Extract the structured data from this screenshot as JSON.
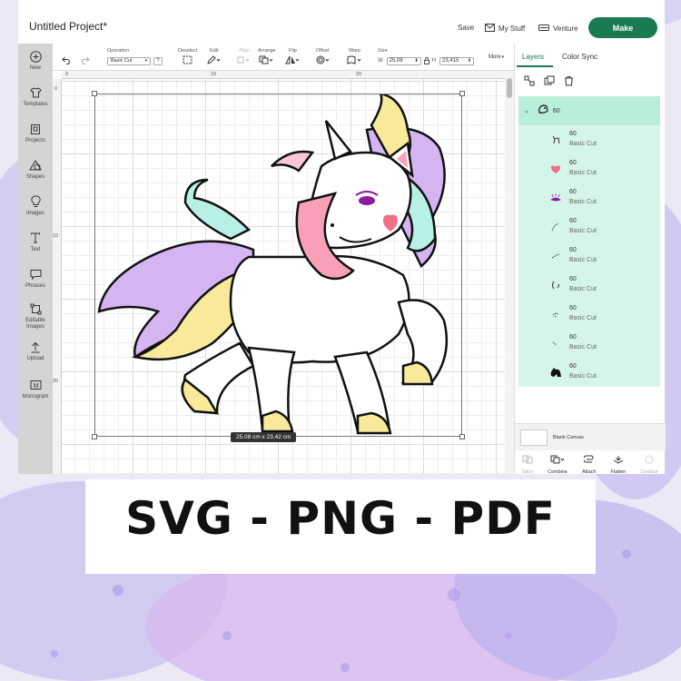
{
  "app": {
    "project_title": "Untitled Project*",
    "save_label": "Save",
    "my_stuff_label": "My Stuff",
    "venture_label": "Venture",
    "make_label": "Make",
    "accent_color": "#1a7a52"
  },
  "left_panel": {
    "items": [
      {
        "label": "New",
        "icon": "plus-circle-icon"
      },
      {
        "label": "Templates",
        "icon": "shirt-icon"
      },
      {
        "label": "Projects",
        "icon": "projects-icon"
      },
      {
        "label": "Shapes",
        "icon": "shapes-icon"
      },
      {
        "label": "Images",
        "icon": "lightbulb-icon"
      },
      {
        "label": "Text",
        "icon": "text-icon"
      },
      {
        "label": "Phrases",
        "icon": "speech-bubble-icon"
      },
      {
        "label": "Editable Images",
        "icon": "editable-images-icon"
      },
      {
        "label": "Upload",
        "icon": "upload-icon"
      },
      {
        "label": "Monogram",
        "icon": "monogram-icon"
      }
    ]
  },
  "toolbar": {
    "operation_label": "Operation",
    "operation_value": "Basic Cut",
    "deselect_label": "Deselect",
    "edit_label": "Edit",
    "align_label": "Align",
    "arrange_label": "Arrange",
    "flip_label": "Flip",
    "offset_label": "Offset",
    "warp_label": "Warp",
    "size_label": "Size",
    "width_prefix": "W",
    "width_value": "25,08",
    "height_prefix": "H",
    "height_value": "23,415",
    "more_label": "More"
  },
  "canvas": {
    "ruler_top": [
      "0",
      "10",
      "20"
    ],
    "ruler_left": [
      "0",
      "10",
      "20"
    ],
    "dimensions_label": "25.08  cm x 23.42  cm"
  },
  "layers_panel": {
    "tab_layers": "Layers",
    "tab_color_sync": "Color Sync",
    "group_name": "60",
    "layers": [
      {
        "name": "60",
        "operation": "Basic Cut",
        "color": "#111111"
      },
      {
        "name": "60",
        "operation": "Basic Cut",
        "color": "#f07088"
      },
      {
        "name": "60",
        "operation": "Basic Cut",
        "color": "#8b1a9e"
      },
      {
        "name": "60",
        "operation": "Basic Cut",
        "color": "#111111"
      },
      {
        "name": "60",
        "operation": "Basic Cut",
        "color": "#111111"
      },
      {
        "name": "60",
        "operation": "Basic Cut",
        "color": "#111111"
      },
      {
        "name": "60",
        "operation": "Basic Cut",
        "color": "#111111"
      },
      {
        "name": "60",
        "operation": "Basic Cut",
        "color": "#111111"
      },
      {
        "name": "60",
        "operation": "Basic Cut",
        "color": "#111111"
      }
    ],
    "blank_canvas_label": "Blank Canvas",
    "bottom_tools": [
      "Slice",
      "Combine",
      "Attach",
      "Flatten",
      "Contour"
    ]
  },
  "banner": {
    "text": "SVG - PNG - PDF"
  }
}
